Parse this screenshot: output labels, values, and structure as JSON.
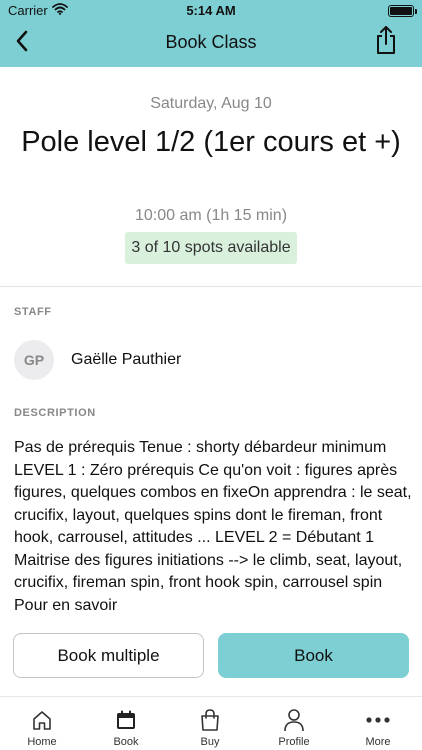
{
  "status_bar": {
    "carrier": "Carrier",
    "time": "5:14 AM"
  },
  "nav": {
    "title": "Book Class",
    "back_icon": "chevron-left-icon",
    "share_icon": "share-icon"
  },
  "class_info": {
    "date": "Saturday, Aug 10",
    "title": "Pole level 1/2 (1er cours et +)",
    "time": "10:00 am (1h 15 min)",
    "spots": "3 of 10 spots available"
  },
  "staff": {
    "section_label": "STAFF",
    "initials": "GP",
    "name": "Gaëlle Pauthier"
  },
  "description": {
    "section_label": "DESCRIPTION",
    "text": "Pas de prérequis Tenue : shorty débardeur minimum LEVEL 1 : Zéro prérequis Ce qu'on voit : figures après figures, quelques combos en fixeOn apprendra : le seat, crucifix, layout, quelques spins dont le fireman, front hook, carrousel, attitudes ... LEVEL 2 = Débutant 1 Maitrise des figures initiations --> le climb, seat, layout, crucifix, fireman spin, front hook spin, carrousel spin Pour en savoir"
  },
  "actions": {
    "book_multiple": "Book multiple",
    "book": "Book"
  },
  "tabs": [
    {
      "label": "Home",
      "icon": "home-icon"
    },
    {
      "label": "Book",
      "icon": "calendar-icon"
    },
    {
      "label": "Buy",
      "icon": "shopping-bag-icon"
    },
    {
      "label": "Profile",
      "icon": "person-icon"
    },
    {
      "label": "More",
      "icon": "more-icon"
    }
  ],
  "colors": {
    "accent": "#7ecfd3",
    "spots_badge": "#d9f0dd",
    "secondary_text": "#888888"
  }
}
